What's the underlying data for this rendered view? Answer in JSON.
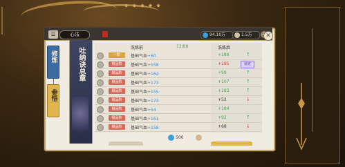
{
  "header": {
    "menu_icon": "menu-icon",
    "title": "心法",
    "currencies": [
      {
        "name": "spirit-stone",
        "color": "#3d9fd8",
        "value": "94.10万"
      },
      {
        "name": "ingot",
        "color": "#cfc2a8",
        "value": "1.5万"
      }
    ]
  },
  "tabs": [
    {
      "label": "修炼",
      "selected": true
    },
    {
      "label": "参悟",
      "selected": false
    }
  ],
  "scroll_title": "吐纳诀总章",
  "table": {
    "col_before": "洗炼前",
    "col_after": "洗炼后",
    "col_mid": "13/88",
    "rows": [
      {
        "quality": "一阶",
        "qcolor": "#d9a441",
        "attr": "基础气血",
        "value": "+60",
        "result": "+186",
        "rcolor": "#4aa05a",
        "mark": "up"
      },
      {
        "quality": "极品阶",
        "qcolor": "#d56a5a",
        "attr": "基础气血",
        "value": "+158",
        "result": "+185",
        "rcolor": "#d04848",
        "mark": "badge",
        "badge": "锁定"
      },
      {
        "quality": "极品阶",
        "qcolor": "#d56a5a",
        "attr": "基础气血",
        "value": "+164",
        "result": "+99",
        "rcolor": "#4aa05a",
        "mark": "up"
      },
      {
        "quality": "极品阶",
        "qcolor": "#d56a5a",
        "attr": "基础气血",
        "value": "+173",
        "result": "+107",
        "rcolor": "#4aa05a",
        "mark": "up"
      },
      {
        "quality": "极品阶",
        "qcolor": "#d56a5a",
        "attr": "基础气血",
        "value": "+155",
        "result": "+183",
        "rcolor": "#4aa05a",
        "mark": "up"
      },
      {
        "quality": "极品阶",
        "qcolor": "#d56a5a",
        "attr": "基础气血",
        "value": "+173",
        "result": "+52",
        "rcolor": "#3a3a3a",
        "mark": "down"
      },
      {
        "quality": "极品阶",
        "qcolor": "#d56a5a",
        "attr": "基础气血",
        "value": "+54",
        "result": "+184",
        "rcolor": "#4aa05a",
        "mark": "none"
      },
      {
        "quality": "极品阶",
        "qcolor": "#d56a5a",
        "attr": "基础气血",
        "value": "+161",
        "result": "+92",
        "rcolor": "#4aa05a",
        "mark": "up"
      },
      {
        "quality": "极品阶",
        "qcolor": "#d56a5a",
        "attr": "基础气血",
        "value": "+158",
        "result": "+68",
        "rcolor": "#3a3a3a",
        "mark": "down"
      }
    ]
  },
  "costs": [
    {
      "name": "spirit-stone",
      "color": "#3d9fd8",
      "value": "500"
    },
    {
      "name": "ingot",
      "color": "#cfb68c",
      "value": ""
    }
  ],
  "close_icon": "close-icon",
  "colors": {
    "accent_blue": "#3d6aa0",
    "accent_gold": "#e0b64c"
  }
}
